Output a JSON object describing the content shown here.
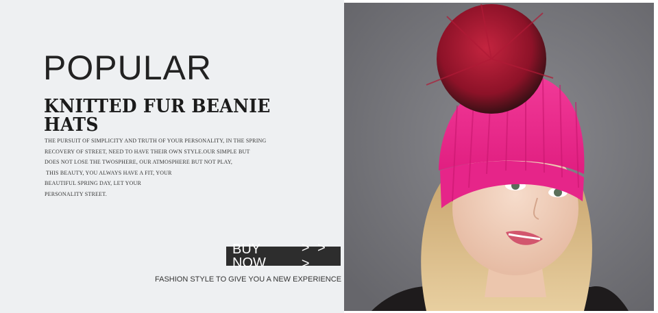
{
  "banner": {
    "headline": "POPULAR",
    "subheadline": "KNITTED FUR BEANIE HATS",
    "description_lines": [
      "THE PURSUIT OF SIMPLICITY AND TRUTH OF YOUR PERSONALITY, IN THE SPRING",
      "RECOVERY OF STREET, NEED TO HAVE THEIR OWN STYLE.OUR SIMPLE BUT",
      "DOES NOT LOSE THE TWOSPHERE, OUR ATMOSPHERE BUT NOT PLAY,",
      " THIS BEAUTY, YOU ALWAYS HAVE A FIT, YOUR",
      "BEAUTIFUL SPRING DAY, LET YOUR",
      "PERSONALITY STREET."
    ],
    "cta_label": "BUY NOW",
    "cta_arrows": "> > >",
    "tagline": "FASHION STYLE TO GIVE YOU A NEW EXPERIENCE"
  },
  "colors": {
    "left_background": "#eef0f2",
    "photo_background": "#75757a",
    "button_background": "#2d2d2d",
    "beanie": "#ee2a8c",
    "pompom": "#9b1530"
  }
}
